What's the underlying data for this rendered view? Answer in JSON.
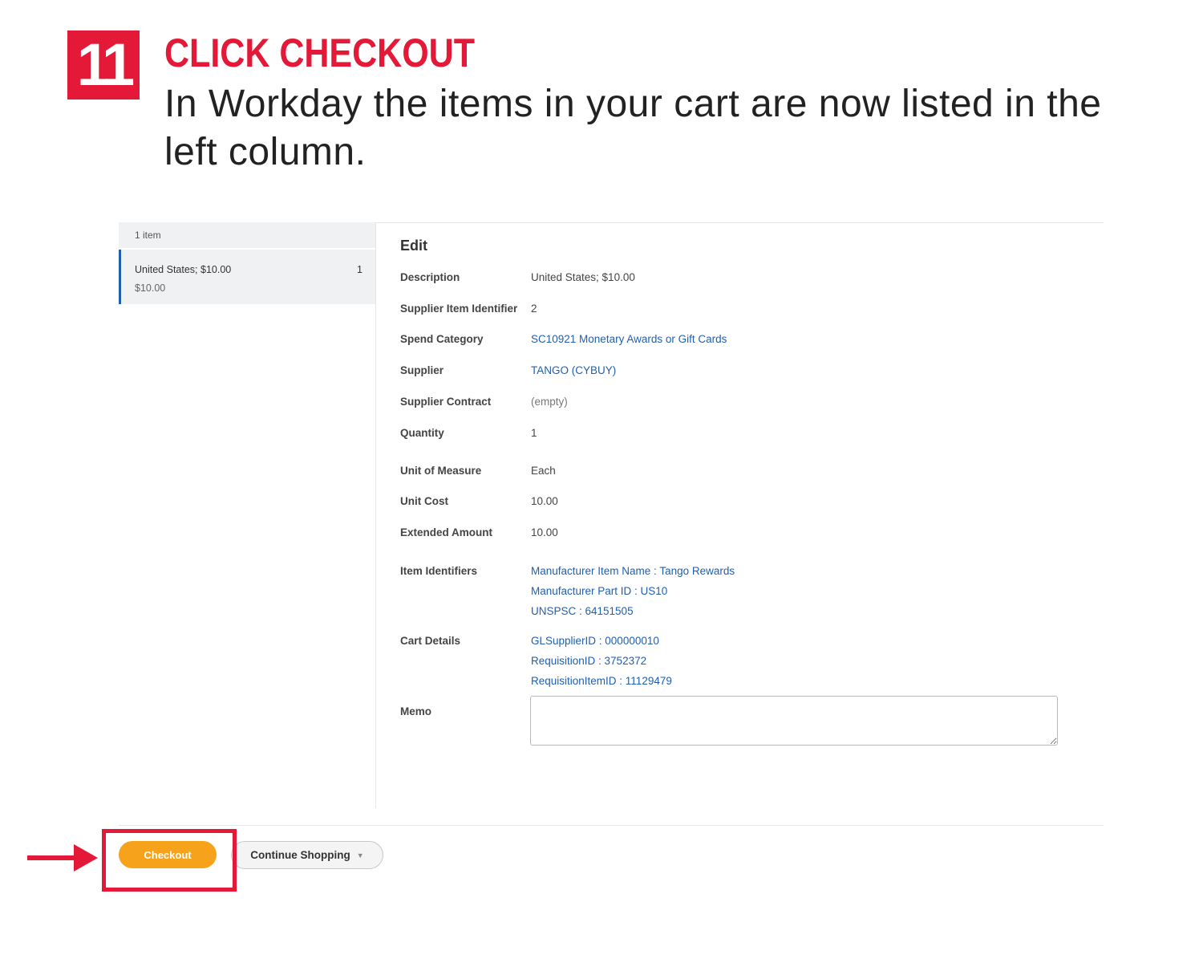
{
  "instruction": {
    "step_number": "11",
    "title": "CLICK CHECKOUT",
    "description": "In Workday the items in your cart are now listed in the left column."
  },
  "cart": {
    "count_label": "1 item",
    "items": [
      {
        "name": "United States; $10.00",
        "price": "$10.00",
        "quantity": "1"
      }
    ]
  },
  "edit": {
    "title": "Edit",
    "fields": {
      "description": {
        "label": "Description",
        "value": "United States; $10.00"
      },
      "supplier_item_identifier": {
        "label": "Supplier Item Identifier",
        "value": "2"
      },
      "spend_category": {
        "label": "Spend Category",
        "value": "SC10921 Monetary Awards or Gift Cards"
      },
      "supplier": {
        "label": "Supplier",
        "value": "TANGO (CYBUY)"
      },
      "supplier_contract": {
        "label": "Supplier Contract",
        "value": "(empty)"
      },
      "quantity": {
        "label": "Quantity",
        "value": "1"
      },
      "unit_of_measure": {
        "label": "Unit of Measure",
        "value": "Each"
      },
      "unit_cost": {
        "label": "Unit Cost",
        "value": "10.00"
      },
      "extended_amount": {
        "label": "Extended Amount",
        "value": "10.00"
      },
      "item_identifiers": {
        "label": "Item Identifiers",
        "values": [
          "Manufacturer Item Name : Tango Rewards",
          "Manufacturer Part ID : US10",
          "UNSPSC : 64151505"
        ]
      },
      "cart_details": {
        "label": "Cart Details",
        "values": [
          "GLSupplierID : 000000010",
          "RequisitionID : 3752372",
          "RequisitionItemID : 11129479"
        ]
      },
      "memo": {
        "label": "Memo",
        "value": ""
      }
    }
  },
  "actions": {
    "checkout_label": "Checkout",
    "continue_shopping_label": "Continue Shopping"
  },
  "colors": {
    "accent_red": "#e31937",
    "checkout_orange": "#f6a31b",
    "link_blue": "#1f5fb0",
    "selected_item_bar": "#1f5fb0"
  },
  "icons": {
    "highlight_arrow": "arrow-right-icon",
    "dropdown": "caret-down-icon"
  }
}
